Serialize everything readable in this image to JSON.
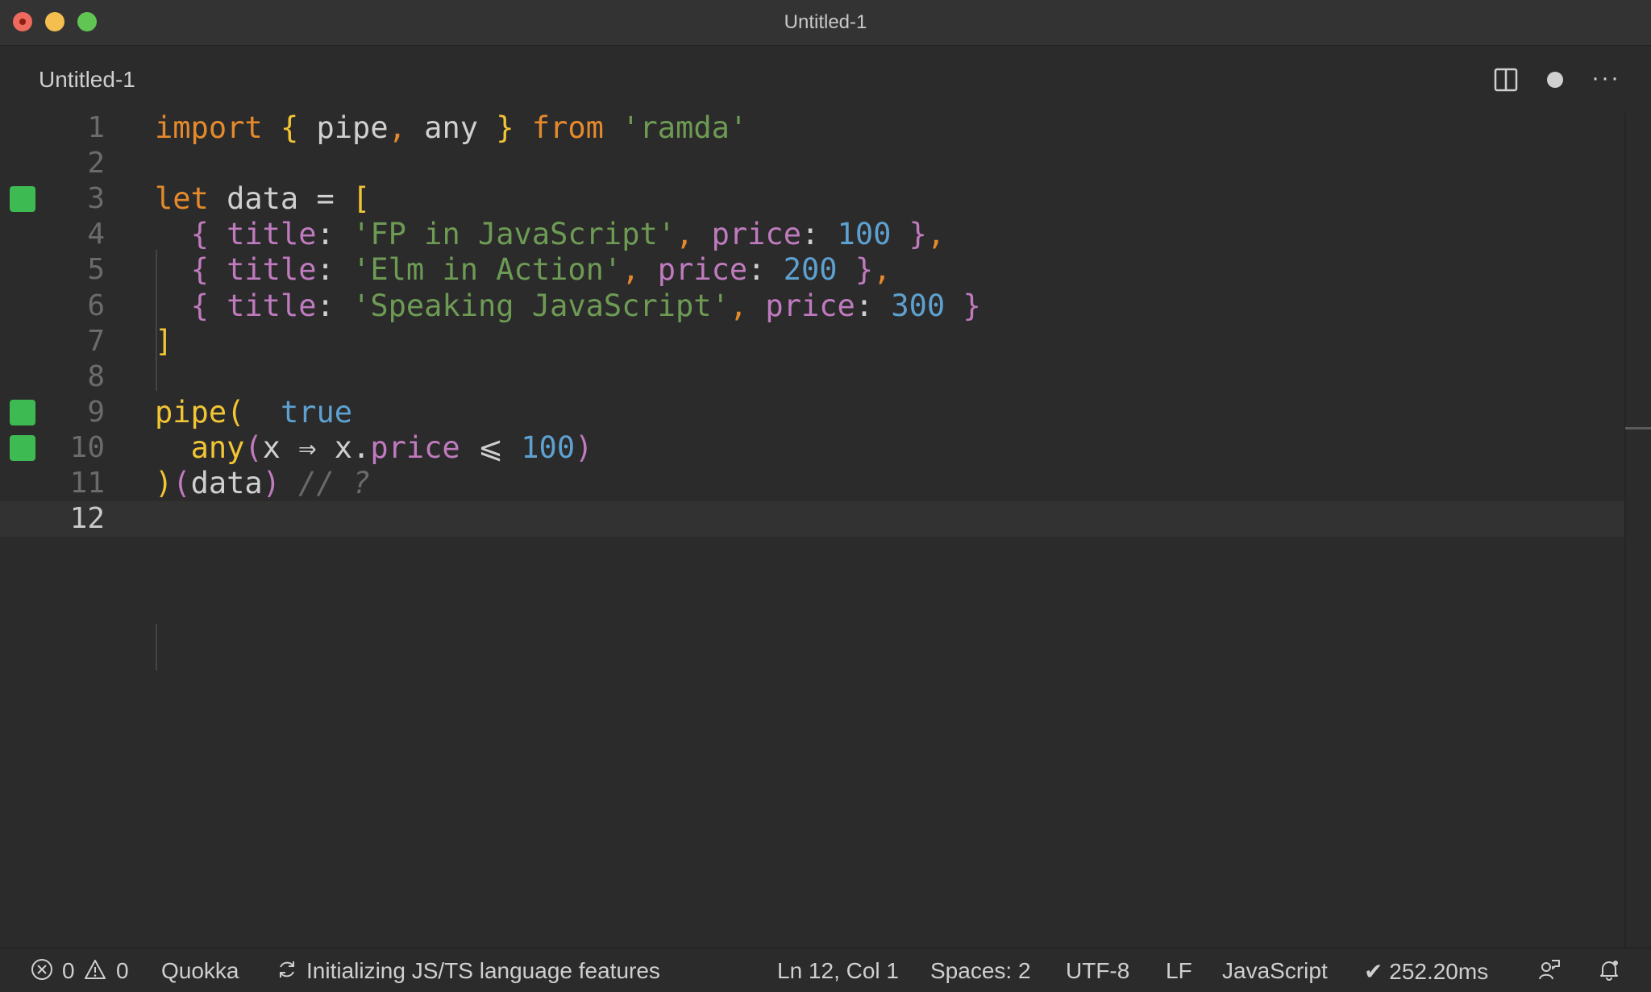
{
  "window": {
    "title": "Untitled-1"
  },
  "tab": {
    "label": "Untitled-1"
  },
  "toolbar": {
    "split_editor_icon": "split-editor-icon",
    "dirty_indicator_icon": "dot-icon",
    "more_actions": "···"
  },
  "editor": {
    "lines": [
      {
        "number": "1",
        "marker": false,
        "tokens": [
          {
            "t": "import",
            "c": "kw"
          },
          {
            "t": " ",
            "c": "pl"
          },
          {
            "t": "{",
            "c": "br"
          },
          {
            "t": " pipe",
            "c": "pl"
          },
          {
            "t": ",",
            "c": "kw"
          },
          {
            "t": " any ",
            "c": "pl"
          },
          {
            "t": "}",
            "c": "br"
          },
          {
            "t": " ",
            "c": "pl"
          },
          {
            "t": "from",
            "c": "kw"
          },
          {
            "t": " ",
            "c": "pl"
          },
          {
            "t": "'ramda'",
            "c": "st"
          }
        ]
      },
      {
        "number": "2",
        "marker": false,
        "tokens": []
      },
      {
        "number": "3",
        "marker": true,
        "tokens": [
          {
            "t": "let",
            "c": "kw"
          },
          {
            "t": " data = ",
            "c": "pl"
          },
          {
            "t": "[",
            "c": "br"
          }
        ]
      },
      {
        "number": "4",
        "marker": false,
        "tokens": [
          {
            "t": "  ",
            "c": "pl"
          },
          {
            "t": "{",
            "c": "pbr"
          },
          {
            "t": " title",
            "c": "pr"
          },
          {
            "t": ": ",
            "c": "pl"
          },
          {
            "t": "'FP in JavaScript'",
            "c": "st"
          },
          {
            "t": ", ",
            "c": "kw"
          },
          {
            "t": "price",
            "c": "pr"
          },
          {
            "t": ": ",
            "c": "pl"
          },
          {
            "t": "100",
            "c": "nu"
          },
          {
            "t": " ",
            "c": "pl"
          },
          {
            "t": "}",
            "c": "pbr"
          },
          {
            "t": ",",
            "c": "kw"
          }
        ]
      },
      {
        "number": "5",
        "marker": false,
        "tokens": [
          {
            "t": "  ",
            "c": "pl"
          },
          {
            "t": "{",
            "c": "pbr"
          },
          {
            "t": " title",
            "c": "pr"
          },
          {
            "t": ": ",
            "c": "pl"
          },
          {
            "t": "'Elm in Action'",
            "c": "st"
          },
          {
            "t": ", ",
            "c": "kw"
          },
          {
            "t": "price",
            "c": "pr"
          },
          {
            "t": ": ",
            "c": "pl"
          },
          {
            "t": "200",
            "c": "nu"
          },
          {
            "t": " ",
            "c": "pl"
          },
          {
            "t": "}",
            "c": "pbr"
          },
          {
            "t": ",",
            "c": "kw"
          }
        ]
      },
      {
        "number": "6",
        "marker": false,
        "tokens": [
          {
            "t": "  ",
            "c": "pl"
          },
          {
            "t": "{",
            "c": "pbr"
          },
          {
            "t": " title",
            "c": "pr"
          },
          {
            "t": ": ",
            "c": "pl"
          },
          {
            "t": "'Speaking JavaScript'",
            "c": "st"
          },
          {
            "t": ", ",
            "c": "kw"
          },
          {
            "t": "price",
            "c": "pr"
          },
          {
            "t": ": ",
            "c": "pl"
          },
          {
            "t": "300",
            "c": "nu"
          },
          {
            "t": " ",
            "c": "pl"
          },
          {
            "t": "}",
            "c": "pbr"
          }
        ]
      },
      {
        "number": "7",
        "marker": false,
        "tokens": [
          {
            "t": "]",
            "c": "br"
          }
        ]
      },
      {
        "number": "8",
        "marker": false,
        "tokens": []
      },
      {
        "number": "9",
        "marker": true,
        "tokens": [
          {
            "t": "pipe",
            "c": "fn"
          },
          {
            "t": "(",
            "c": "br"
          },
          {
            "t": "  ",
            "c": "pl"
          },
          {
            "t": "true",
            "c": "bool"
          }
        ]
      },
      {
        "number": "10",
        "marker": true,
        "tokens": [
          {
            "t": "  ",
            "c": "pl"
          },
          {
            "t": "any",
            "c": "fn"
          },
          {
            "t": "(",
            "c": "pbr"
          },
          {
            "t": "x ⇒ x.",
            "c": "pl"
          },
          {
            "t": "price",
            "c": "pr"
          },
          {
            "t": " ⩽ ",
            "c": "pl"
          },
          {
            "t": "100",
            "c": "nu"
          },
          {
            "t": ")",
            "c": "pbr"
          }
        ]
      },
      {
        "number": "11",
        "marker": false,
        "tokens": [
          {
            "t": ")",
            "c": "br"
          },
          {
            "t": "(",
            "c": "pbr"
          },
          {
            "t": "data",
            "c": "pl"
          },
          {
            "t": ")",
            "c": "pbr"
          },
          {
            "t": " ",
            "c": "pl"
          },
          {
            "t": "// ?",
            "c": "cm"
          }
        ]
      },
      {
        "number": "12",
        "marker": false,
        "current": true,
        "tokens": []
      }
    ]
  },
  "statusbar": {
    "errors": "0",
    "warnings": "0",
    "quokka": "Quokka",
    "initializing": "Initializing JS/TS language features",
    "position": "Ln 12, Col 1",
    "spaces": "Spaces: 2",
    "encoding": "UTF-8",
    "eol": "LF",
    "language": "JavaScript",
    "timing": "✔ 252.20ms"
  },
  "colors": {
    "keyword": "#e58a2c",
    "bracket": "#f2c535",
    "string": "#6e9b54",
    "property": "#c07bbf",
    "number": "#5ea1d0",
    "marker": "#3dba52"
  }
}
